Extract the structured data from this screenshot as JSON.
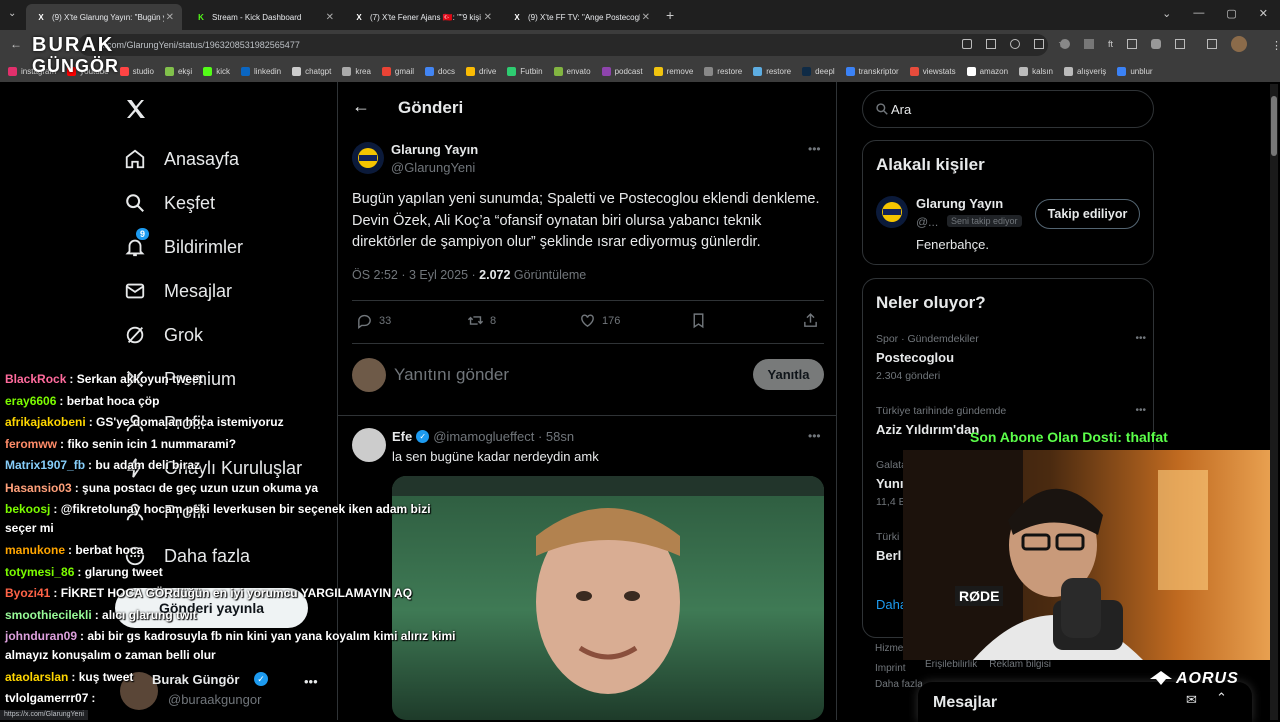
{
  "browser": {
    "tabs": [
      {
        "title": "(9) X'te Glarung Yayın: \"Bugün y",
        "fav": "X",
        "color": "#fff"
      },
      {
        "title": "Stream - Kick Dashboard",
        "fav": "K",
        "color": "#53fc18"
      },
      {
        "title": "(7) X'te Fener Ajans 🇹🇷: \"\"9 kişi il",
        "fav": "X",
        "color": "#fff"
      },
      {
        "title": "(9) X'te FF TV: \"Ange Postecogl",
        "fav": "X",
        "color": "#fff"
      }
    ],
    "url": "x.com/GlarungYeni/status/1963208531982565477",
    "bookmarks": [
      {
        "label": "instagram",
        "color": "#e1306c"
      },
      {
        "label": "youtube",
        "color": "#ff0000"
      },
      {
        "label": "studio",
        "color": "#ff4444"
      },
      {
        "label": "ekşi",
        "color": "#81c14b"
      },
      {
        "label": "kick",
        "color": "#53fc18"
      },
      {
        "label": "linkedin",
        "color": "#0a66c2"
      },
      {
        "label": "chatgpt",
        "color": "#cccccc"
      },
      {
        "label": "krea",
        "color": "#aaaaaa"
      },
      {
        "label": "gmail",
        "color": "#ea4335"
      },
      {
        "label": "docs",
        "color": "#4285f4"
      },
      {
        "label": "drive",
        "color": "#fbbc04"
      },
      {
        "label": "Futbin",
        "color": "#2ecc71"
      },
      {
        "label": "envato",
        "color": "#82b541"
      },
      {
        "label": "podcast",
        "color": "#8e44ad"
      },
      {
        "label": "remove",
        "color": "#f1c40f"
      },
      {
        "label": "restore",
        "color": "#888888"
      },
      {
        "label": "restore",
        "color": "#5dade2"
      },
      {
        "label": "deepl",
        "color": "#0f2b46"
      },
      {
        "label": "transkriptor",
        "color": "#3b82f6"
      },
      {
        "label": "viewstats",
        "color": "#e74c3c"
      },
      {
        "label": "amazon",
        "color": "#ffffff"
      },
      {
        "label": "kalsın",
        "color": "#bbbbbb"
      },
      {
        "label": "alışveriş",
        "color": "#bbbbbb"
      },
      {
        "label": "unblur",
        "color": "#3b82f6"
      }
    ]
  },
  "nav": {
    "items": [
      "Anasayfa",
      "Keşfet",
      "Bildirimler",
      "Mesajlar",
      "Grok",
      "Premium",
      "Profil",
      "Onaylı Kuruluşlar",
      "Profil",
      "Daha fazla"
    ],
    "notif_badge": "9",
    "post_button": "Gönderi yayınla",
    "account_name": "Burak Güngör",
    "account_handle": "@buraakgungor"
  },
  "post": {
    "header": "Gönderi",
    "author": "Glarung Yayın",
    "handle": "@GlarungYeni",
    "text": "Bugün yapılan yeni sunumda; Spaletti ve Postecoglou eklendi denkleme. Devin Özek, Ali Koç’a “ofansif oynatan biri olursa yabancı teknik direktörler de şampiyon olur” şeklinde ısrar ediyormuş günlerdir.",
    "time": "ÖS 2:52 · 3 Eyl 2025 · ",
    "views": "2.072",
    "views_label": "Görüntüleme",
    "replies": "33",
    "reposts": "8",
    "likes": "176",
    "reply_placeholder": "Yanıtını gönder",
    "reply_button": "Yanıtla"
  },
  "reply_post": {
    "author": "Efe",
    "handle": "@imamoglueffect · 58sn",
    "text": "la sen bugüne kadar nerdeydin amk"
  },
  "right": {
    "search_placeholder": "Ara",
    "related_title": "Alakalı kişiler",
    "related_name": "Glarung Yayın",
    "related_handle": "@...",
    "follows_you": "Seni takip ediyor",
    "follow_button": "Takip ediliyor",
    "related_bio": "Fenerbahçe.",
    "trends_title": "Neler oluyor?",
    "trends": [
      {
        "meta": "Spor · Gündemdekiler",
        "name": "Postecoglou",
        "count": "2.304 gönderi"
      },
      {
        "meta": "Türkiye tarihinde gündemde",
        "name": "Aziz Yıldırım'dan",
        "count": ""
      },
      {
        "meta": "Galata",
        "name": "Yunı",
        "count": "11,4 B"
      },
      {
        "meta": "Türki",
        "name": "Berl",
        "count": ""
      },
      {
        "meta": "",
        "name": "Daha",
        "count": ""
      }
    ],
    "footer": [
      "Hizmet",
      "Imprint",
      "Erişilebilirlik",
      "Reklam bilgisi",
      "Daha fazla"
    ],
    "messages": "Mesajlar"
  },
  "stream": {
    "logo_top": "BURAK",
    "logo_bottom": "GÜNGÖR",
    "subscriber": "Son Abone Olan Dosti: thalfat",
    "brand": "AORUS",
    "mic_label": "RØDE",
    "chat": [
      {
        "user": "BlackRock",
        "color": "#ff6b9d",
        "msg": ": Serkan akkoyun tweet"
      },
      {
        "user": "eray6606",
        "color": "#7cfc00",
        "msg": ": berbat hoca çöp"
      },
      {
        "user": "afrikajakobeni",
        "color": "#ffd700",
        "msg": ": GS'ye domalan hoca istemiyoruz"
      },
      {
        "user": "feromww",
        "color": "#ff8c69",
        "msg": ": fiko senin icin 1 nummarami?"
      },
      {
        "user": "Matrix1907_fb",
        "color": "#87cefa",
        "msg": ": bu adam deli biraz"
      },
      {
        "user": "Hasansio03",
        "color": "#ffa07a",
        "msg": ": şuna postacı de geç uzun uzun okuma ya"
      },
      {
        "user": "bekoosj",
        "color": "#7cfc00",
        "msg": ": @fikretolunay hocam peki leverkusen bir seçenek iken adam bizi"
      },
      {
        "user": "",
        "color": "#fff",
        "msg": "seçer mi"
      },
      {
        "user": "manukone",
        "color": "#ffa500",
        "msg": ": berbat hoca"
      },
      {
        "user": "totymesi_86",
        "color": "#7cfc00",
        "msg": ": glarung tweet"
      },
      {
        "user": "Byozi41",
        "color": "#ff6347",
        "msg": ": FİKRET HOCA GÖRdüğün en iyi yorumcu YARGILAMAYIN AQ"
      },
      {
        "user": "smoothiecilekli",
        "color": "#98fb98",
        "msg": ": alıcı glarung twit"
      },
      {
        "user": "johnduran09",
        "color": "#dda0dd",
        "msg": ": abi bir gs kadrosuyla fb nin kini yan yana koyalım kimi alırız kimi"
      },
      {
        "user": "",
        "color": "#fff",
        "msg": "almayız konuşalım o zaman belli olur"
      },
      {
        "user": "ataolarslan",
        "color": "#ffd700",
        "msg": ": kuş tweet"
      },
      {
        "user": "tvlolgamerrr07",
        "color": "#ffffff",
        "msg": ":"
      }
    ],
    "status_url": "https://x.com/GlarungYeni"
  }
}
